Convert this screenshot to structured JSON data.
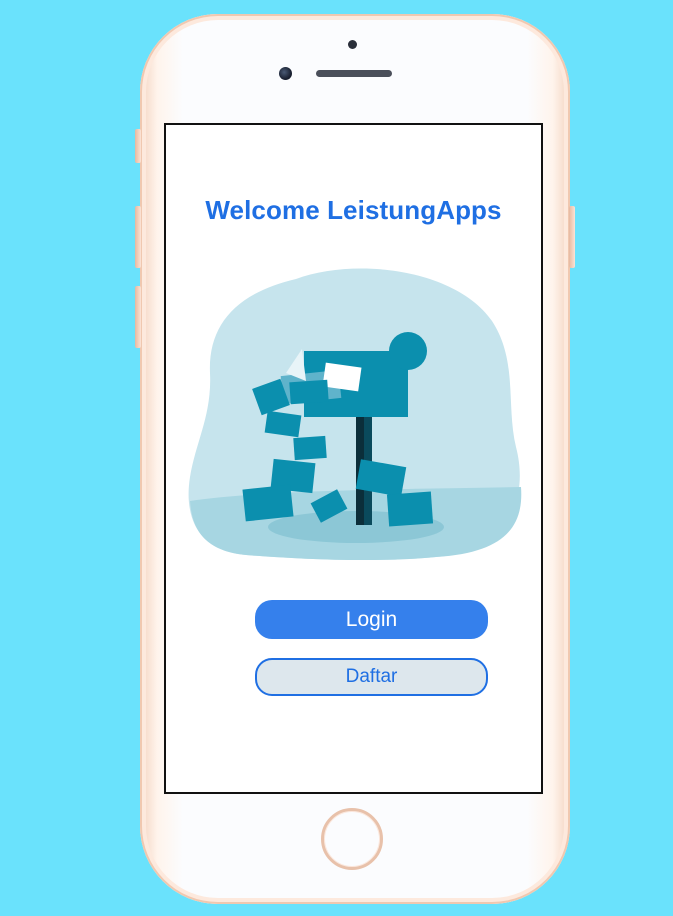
{
  "app": {
    "welcome_title": "Welcome LeistungApps"
  },
  "actions": {
    "login_label": "Login",
    "register_label": "Daftar"
  },
  "theme": {
    "background": "#6ae2fc",
    "accent": "#1f6fe3",
    "primary_button": "#3580ec",
    "secondary_button_bg": "#dde7ed",
    "illustration_blob": "#c6e4ed",
    "illustration_teal": "#0b8fae"
  },
  "illustration": {
    "icon": "mailbox-illustration"
  }
}
